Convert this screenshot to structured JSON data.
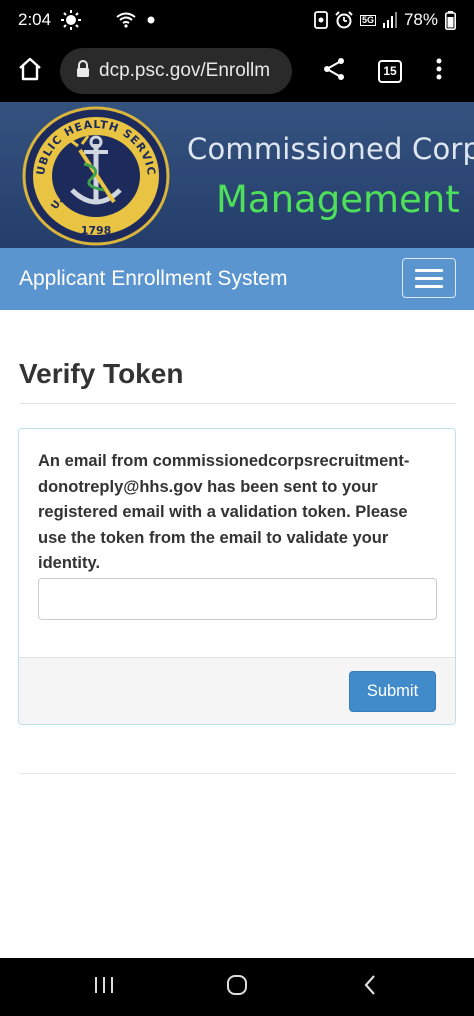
{
  "status_bar": {
    "time": "2:04",
    "network": "5G",
    "battery": "78%"
  },
  "browser": {
    "url": "dcp.psc.gov/Enrollm",
    "tab_count": "15"
  },
  "banner": {
    "seal_text_top": "PUBLIC HEALTH SERVICE",
    "seal_text_left": "U.S.",
    "seal_year": "1798",
    "line1": "Commissioned Corps",
    "line2": "Management I"
  },
  "navbar": {
    "title": "Applicant Enrollment System"
  },
  "main": {
    "title": "Verify Token",
    "message": "An email from commissionedcorpsrecruitment-donotreply@hhs.gov has been sent to your registered email with a validation token. Please use the token from the email to validate your identity.",
    "token_input_value": "",
    "submit_label": "Submit"
  },
  "colors": {
    "navbar": "#5b95cf",
    "banner": "#2c4a78",
    "banner_green": "#4ee05a",
    "primary_button": "#428bca",
    "panel_border": "#bce2e8"
  }
}
